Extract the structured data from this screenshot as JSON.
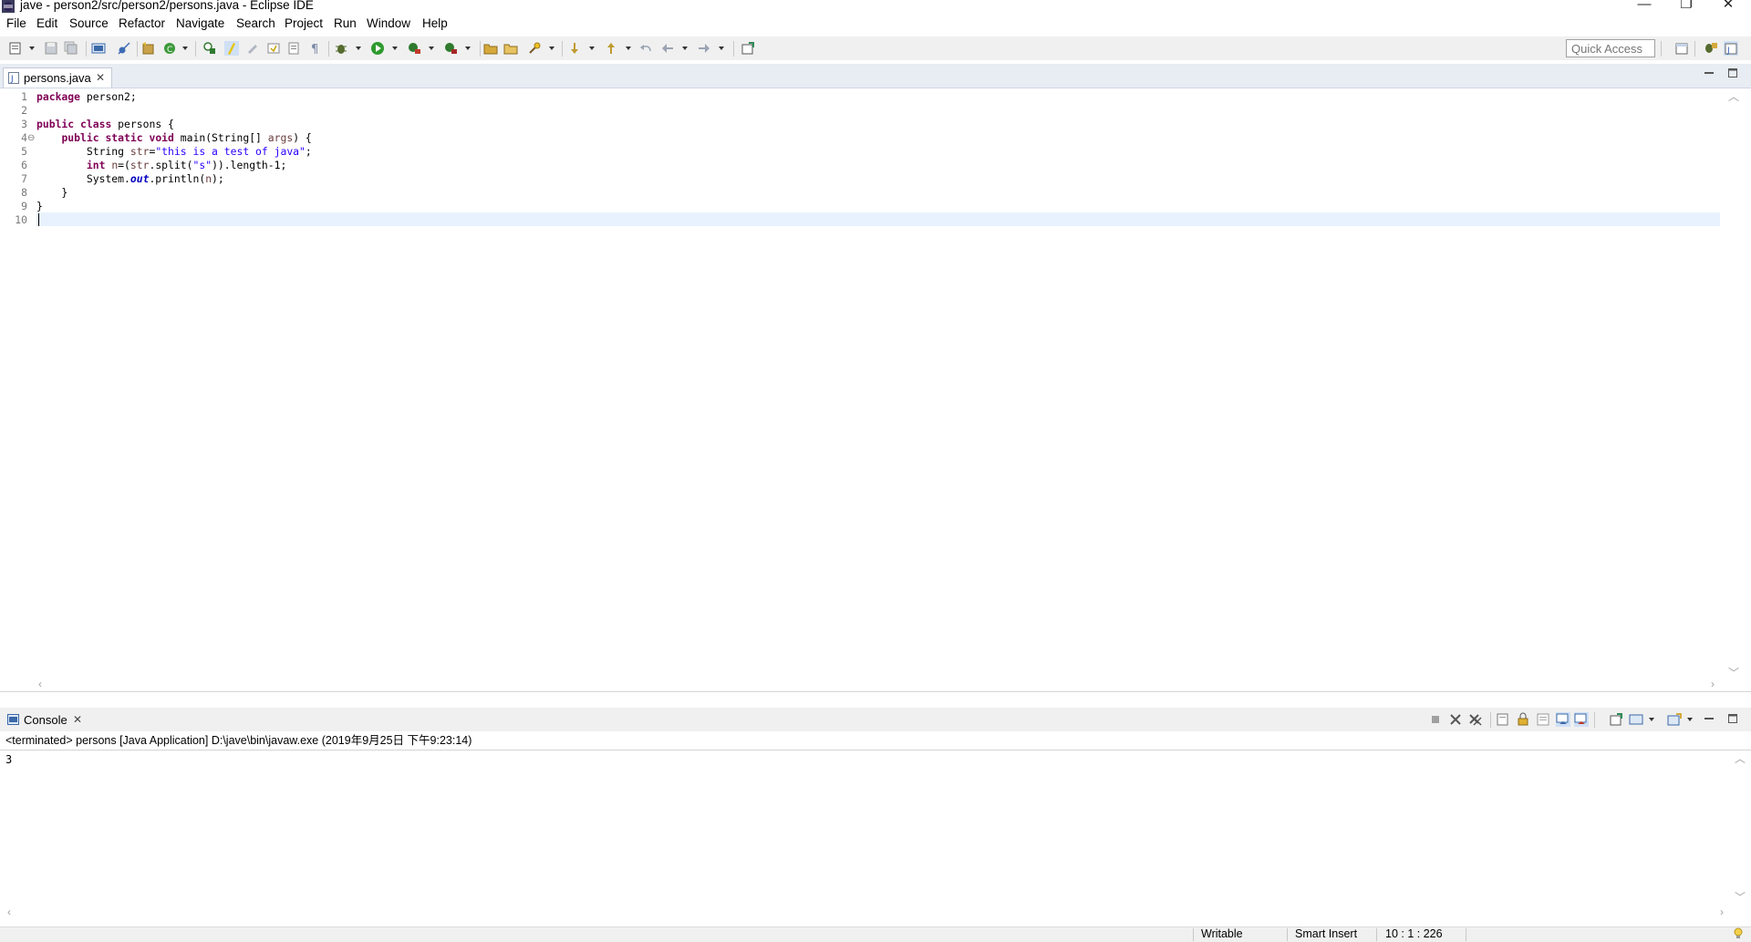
{
  "window": {
    "title": "jave - person2/src/person2/persons.java - Eclipse IDE",
    "minimize_glyph": "—",
    "restore_glyph": "❐",
    "close_glyph": "✕"
  },
  "menu": [
    "File",
    "Edit",
    "Source",
    "Refactor",
    "Navigate",
    "Search",
    "Project",
    "Run",
    "Window",
    "Help"
  ],
  "toolbar": {
    "quick_access_placeholder": "Quick Access",
    "icons": [
      "new-icon",
      "save-icon",
      "save-all-icon",
      "console-icon",
      "skip-breakpoints-icon",
      "new-java-package-icon",
      "new-java-class-icon",
      "open-type-icon",
      "toggle-mark-occurrences-icon",
      "next-annotation-icon",
      "show-whitespace-icon",
      "debug-icon",
      "run-icon",
      "coverage-icon",
      "external-tools-icon",
      "open-folder-icon",
      "search-icon",
      "back-icon",
      "forward-icon",
      "perspective-icon"
    ]
  },
  "editor": {
    "tab_label": "persons.java",
    "tab_close": "✕",
    "lines": [
      {
        "n": "1",
        "text": "package person2;"
      },
      {
        "n": "2",
        "text": ""
      },
      {
        "n": "3",
        "text": "public class persons {"
      },
      {
        "n": "4",
        "text": "    public static void main(String[] args) {"
      },
      {
        "n": "5",
        "text": "        String str=\"this is a test of java\";"
      },
      {
        "n": "6",
        "text": "        int n=(str.split(\"s\")).length-1;"
      },
      {
        "n": "7",
        "text": "        System.out.println(n);"
      },
      {
        "n": "8",
        "text": "    }"
      },
      {
        "n": "9",
        "text": "}"
      },
      {
        "n": "10",
        "text": ""
      }
    ],
    "folding_marker": "⊖"
  },
  "console": {
    "tab_label": "Console",
    "tab_close": "✕",
    "status": "<terminated> persons [Java Application] D:\\jave\\bin\\javaw.exe (2019年9月25日 下午9:23:14)",
    "output": "3"
  },
  "statusbar": {
    "writable": "Writable",
    "insert_mode": "Smart Insert",
    "position": "10 : 1 : 226"
  },
  "colors": {
    "keyword": "#7f0055",
    "string": "#2a00ff",
    "current_line": "#e8f2fe",
    "toolbar_bg": "#f0f0f0"
  }
}
